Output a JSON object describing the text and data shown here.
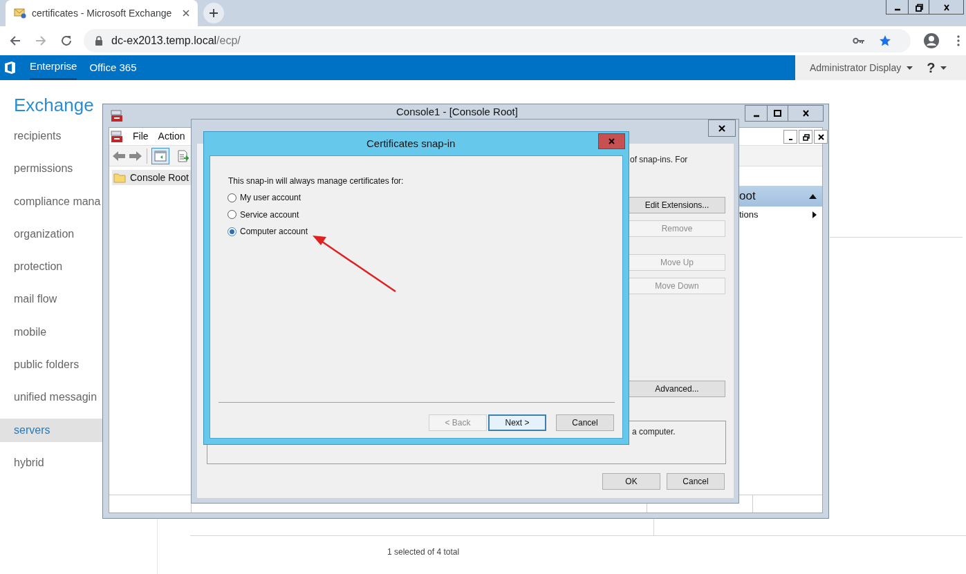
{
  "browser": {
    "tab": {
      "title": "certificates - Microsoft Exchange"
    },
    "address": {
      "host": "dc-ex2013.temp.local",
      "path": "/ecp/"
    }
  },
  "topbar": {
    "links": [
      {
        "label": "Enterprise",
        "selected": true
      },
      {
        "label": "Office 365",
        "selected": false
      }
    ],
    "user": "Administrator Display",
    "help": "?"
  },
  "eac": {
    "title": "Exchange",
    "nav": [
      {
        "label": "recipients",
        "selected": false
      },
      {
        "label": "permissions",
        "selected": false
      },
      {
        "label": "compliance mana",
        "selected": false
      },
      {
        "label": "organization",
        "selected": false
      },
      {
        "label": "protection",
        "selected": false
      },
      {
        "label": "mail flow",
        "selected": false
      },
      {
        "label": "mobile",
        "selected": false
      },
      {
        "label": "public folders",
        "selected": false
      },
      {
        "label": "unified messagin",
        "selected": false
      },
      {
        "label": "servers",
        "selected": true
      },
      {
        "label": "hybrid",
        "selected": false
      }
    ],
    "footer": "1 selected of 4 total"
  },
  "console": {
    "title": "Console1 - [Console Root]",
    "menu": [
      "File",
      "Action"
    ],
    "tree": [
      {
        "label": "Console Root",
        "selected": true
      }
    ],
    "actions": {
      "header": "oot",
      "items": [
        "tions"
      ]
    }
  },
  "snapins_dialog": {
    "intro": "of snap-ins. For",
    "buttons": [
      {
        "label": "Edit Extensions...",
        "disabled": false
      },
      {
        "label": "Remove",
        "disabled": true
      },
      {
        "label": "Move Up",
        "disabled": true
      },
      {
        "label": "Move Down",
        "disabled": true
      },
      {
        "label": "Advanced...",
        "disabled": false
      }
    ],
    "description": "a computer.",
    "footer_buttons": [
      "OK",
      "Cancel"
    ]
  },
  "cert_dialog": {
    "title": "Certificates snap-in",
    "prompt": "This snap-in will always manage certificates for:",
    "options": [
      {
        "label": "My user account",
        "selected": false
      },
      {
        "label": "Service account",
        "selected": false
      },
      {
        "label": "Computer account",
        "selected": true
      }
    ],
    "buttons": [
      {
        "label": "< Back",
        "disabled": true,
        "default": false
      },
      {
        "label": "Next >",
        "disabled": false,
        "default": true
      },
      {
        "label": "Cancel",
        "disabled": false,
        "default": false
      }
    ]
  }
}
